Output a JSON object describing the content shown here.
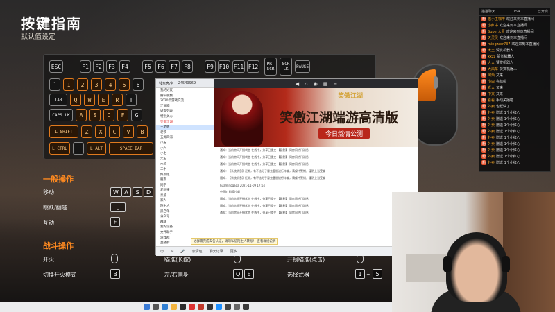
{
  "guide": {
    "title": "按键指南",
    "subtitle": "默认值设定"
  },
  "keyboard": {
    "fn_row": [
      "ESC",
      "F1",
      "F2",
      "F3",
      "F4",
      "F5",
      "F6",
      "F7",
      "F8",
      "F9",
      "F10",
      "F11",
      "F12",
      "PRT SCR",
      "SCR LK",
      "PAUSE"
    ],
    "num_row": [
      "`",
      "1",
      "2",
      "3",
      "4",
      "5",
      "6"
    ],
    "q_row": [
      "TAB",
      "Q",
      "W",
      "E",
      "R",
      "T"
    ],
    "a_row": [
      "CAPS LK",
      "A",
      "S",
      "D",
      "F",
      "G"
    ],
    "z_row": [
      "L SHIFT",
      "Z",
      "X",
      "C",
      "V",
      "B"
    ],
    "bottom_row": [
      "L CTRL",
      "L ALT",
      "SPACE BAR"
    ]
  },
  "general": {
    "heading": "一般操作",
    "move_label": "移动",
    "move_keys": [
      "W",
      "A",
      "S",
      "D"
    ],
    "jump_label": "跳跃/翻越",
    "jump_key": "⎵",
    "interact_label": "互动",
    "interact_key": "F"
  },
  "combat": {
    "heading": "战斗操作",
    "fire_label": "开火",
    "aim_label": "瞄准(长按)",
    "scope_label": "开镜瞄准(点击)",
    "mode_label": "切换开火模式",
    "mode_key": "B",
    "lean_label": "左/右侧身",
    "lean_keys": [
      "Q",
      "E"
    ],
    "weapon_label": "选择武器",
    "weapon_keys": [
      "1",
      "~",
      "5"
    ]
  },
  "chat": {
    "header_left": "猫猫聊天",
    "header_mid": "154",
    "header_right": "已开启",
    "messages": [
      {
        "name": "猫小主咖啡",
        "text": "欢迎来到本直播间"
      },
      {
        "name": "小红书",
        "text": "欢迎来到本直播间"
      },
      {
        "name": "Super大豆",
        "text": "欢迎来到本直播间"
      },
      {
        "name": "天灵灵",
        "text": "欢迎来到本直播间"
      },
      {
        "name": "mingzzer737",
        "text": "欢迎来到本直播间"
      },
      {
        "name": "大王",
        "text": "赞赏机器人"
      },
      {
        "name": "xxzz",
        "text": "赞赏机器人"
      },
      {
        "name": "大大",
        "text": "赞赏机器人"
      },
      {
        "name": "大风车",
        "text": "赞赏机器人"
      },
      {
        "name": "阿灿",
        "text": "又来"
      },
      {
        "name": "小白",
        "text": "完结啦"
      },
      {
        "name": "老大",
        "text": "又来"
      },
      {
        "name": "中文",
        "text": "又来"
      },
      {
        "name": "看看",
        "text": "手动关播吧"
      },
      {
        "name": "外卖",
        "text": "也赶快了"
      },
      {
        "name": "外卖",
        "text": "赠送 1个小红心"
      },
      {
        "name": "外卖",
        "text": "赠送 1个小红心"
      },
      {
        "name": "外卖",
        "text": "赠送 1个小红心"
      },
      {
        "name": "外卖",
        "text": "赠送 1个小红心"
      },
      {
        "name": "外卖",
        "text": "赠送 1个小红心"
      },
      {
        "name": "外卖",
        "text": "赠送 1个小红心"
      },
      {
        "name": "外卖",
        "text": "赠送 1个小红心"
      },
      {
        "name": "外卖",
        "text": "赠送 1个小红心"
      },
      {
        "name": "外卖",
        "text": "赠送 1个小红心"
      }
    ]
  },
  "messenger": {
    "window_title": "钱东亮/名",
    "window_id": "24549969",
    "sidebar": [
      "我的好友",
      "腾讯视频",
      "2020年游戏交流",
      "江湖喵",
      "好友列表",
      "特别关心",
      "笑傲江湖",
      "王老板",
      "老铁",
      "五湖四海",
      "小五",
      "小六",
      "小七",
      "大王",
      "天蓝",
      "二十",
      "好友组",
      "朋友",
      "同学",
      "老同事",
      "亲戚",
      "家人",
      "陌生人",
      "黑名单",
      "公众号",
      "群聊",
      "我的设备",
      "文件助手",
      "游戏群",
      "直播群"
    ],
    "banner_logo": "笑傲江湖",
    "banner_title": "笑傲江湖端游高清版",
    "banner_sub": "今日燃情公测",
    "lines": [
      "通知：当前房间开播状态 在线中，分享已提交  【复制】 同房间热门消息",
      "通知：当前房间开播状态 在线中，分享已提交  【复制】 同房间热门消息",
      "通知：当前房间开播状态 在线中，分享已提交  【复制】 同房间热门消息",
      "通知：【系统消息】近期，有不法分子冒充客服进行诈骗，请保持警惕，谨防上当受骗",
      "通知：【系统消息】近期，有不法分子冒充客服进行诈骗，请保持警惕，谨防上当受骗",
      "huaminggaga 2021-11-09 17:14",
      "中国in  稍等片刻",
      "通知：当前房间开播状态 在线中，分享已提交  【复制】 同房间热门消息",
      "通知：当前房间开播状态 在线中，分享已提交  【复制】 同房间热门消息",
      "通知：当前房间开播状态 在线中，分享已提交  【复制】 同房间热门消息"
    ],
    "notice": "进群需完成实名认证，请勿私信陌生人转账！ 查看群规说明",
    "bottom_items": [
      "☺",
      "✂",
      "🎤",
      "表情包",
      "聊天记录",
      "更多"
    ]
  },
  "colors": {
    "accent": "#ff8a20",
    "keyhl": "#e07a1e"
  }
}
